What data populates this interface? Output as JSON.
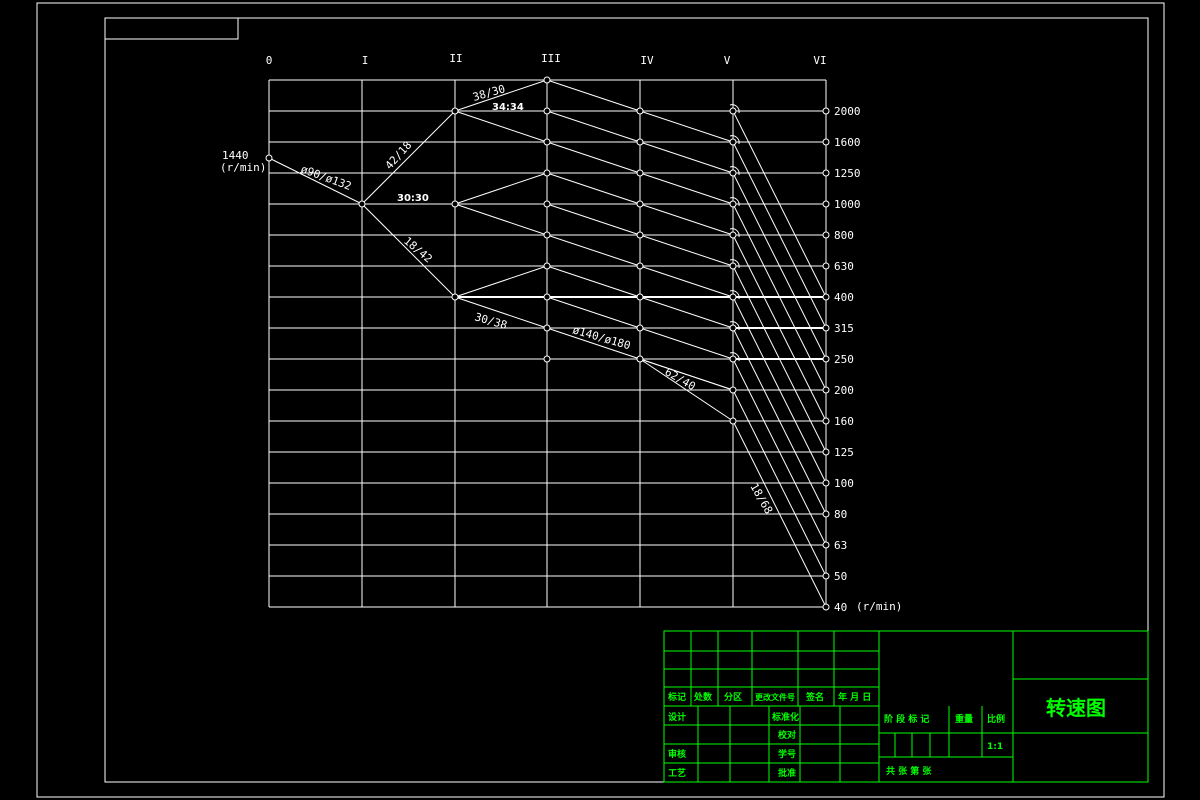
{
  "axis_labels": [
    "0",
    "I",
    "II",
    "III",
    "IV",
    "V",
    "VI"
  ],
  "input_speed": "1440",
  "input_unit": "(r/min)",
  "speeds": [
    "2000",
    "1600",
    "1250",
    "1000",
    "800",
    "630",
    "400",
    "315",
    "250",
    "200",
    "160",
    "125",
    "100",
    "80",
    "63",
    "50",
    "40"
  ],
  "speed_unit": "(r/min)",
  "ratio_labels": {
    "pulley_1": "ø90/ø132",
    "g1": "42/18",
    "g2": "30:30",
    "g3": "18/42",
    "g4": "38/30",
    "g5": "34:34",
    "g6": "30/38",
    "pulley_2": "ø140/ø180",
    "g7": "62/40",
    "g8": "18/68"
  },
  "title_block": {
    "r1": [
      "标记",
      "处数",
      "分区",
      "更改文件号",
      "签名",
      "年 月 日"
    ],
    "design": "设计",
    "standardize": "标准化",
    "proof": "校对",
    "review": "审核",
    "student_no": "学号",
    "process": "工艺",
    "approve": "批准",
    "stage_mark": "阶 段 标 记",
    "weight": "重量",
    "scale": "比例",
    "scale_value": "1:1",
    "sheets": "共   张   第   张",
    "drawing_title": "转速图"
  }
}
